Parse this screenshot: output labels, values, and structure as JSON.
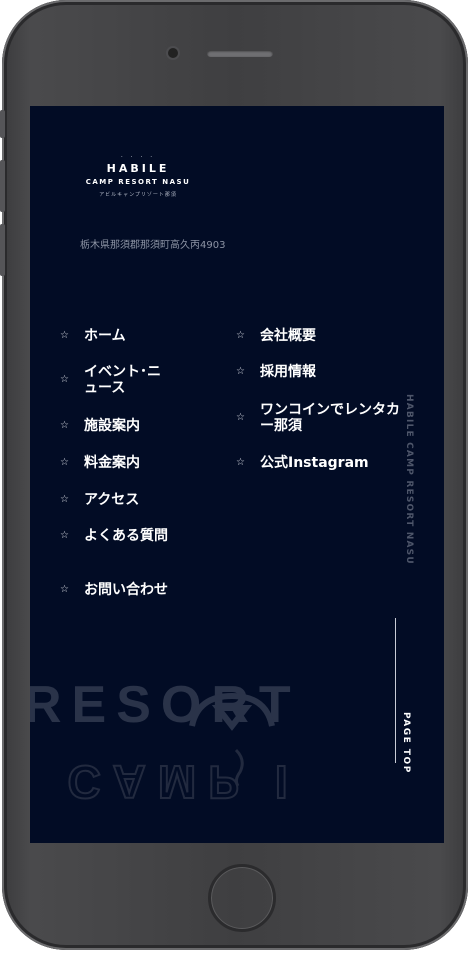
{
  "logo": {
    "dots": "· · · ·",
    "brand": "HABILE",
    "sub": "CAMP RESORT NASU",
    "kana": "アビルキャンプリゾート那須"
  },
  "address": "栃木県那須郡那須町高久丙4903",
  "menu_left": [
    {
      "label": "ホーム"
    },
    {
      "label": "イベント･ニュース"
    },
    {
      "label": "施設案内"
    },
    {
      "label": "料金案内"
    },
    {
      "label": "アクセス"
    },
    {
      "label": "よくある質問"
    },
    {
      "label": "お問い合わせ"
    }
  ],
  "menu_right": [
    {
      "label": "会社概要"
    },
    {
      "label": "採用情報"
    },
    {
      "label": "ワンコインでレンタカー那須"
    },
    {
      "label": "公式Instagram"
    }
  ],
  "vertical_brand": "HABILE CAMP RESORT NASU",
  "page_top": "PAGE TOP",
  "watermark": {
    "resort": "RESORT",
    "camp_mirrored": "E CAMP I"
  },
  "icons": {
    "menu_bullet": "star-outline-icon"
  },
  "colors": {
    "background": "#020c25",
    "text": "#ffffff",
    "muted": "#8c93a4"
  }
}
